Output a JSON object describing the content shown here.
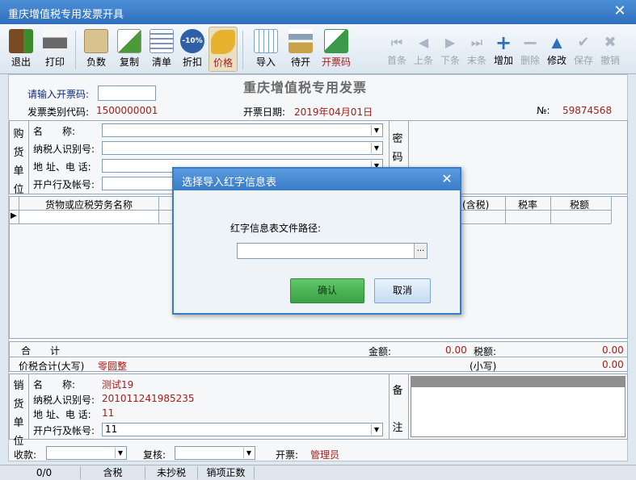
{
  "window": {
    "title": "重庆增值税专用发票开具"
  },
  "toolbar": {
    "left": [
      {
        "label": "退出",
        "icon": "exit-icon",
        "color": "#6b3e1e"
      },
      {
        "label": "打印",
        "icon": "printer-icon",
        "color": "#5a5a5a"
      },
      {
        "label": "负数",
        "icon": "folder-icon",
        "color": "#c9b07a"
      },
      {
        "label": "复制",
        "icon": "copy-icon",
        "color": "#4a9a3a"
      },
      {
        "label": "清单",
        "icon": "list-icon",
        "color": "#6a86b0"
      },
      {
        "label": "折扣",
        "icon": "discount-icon",
        "color": "#2f5fa8"
      },
      {
        "label": "价格",
        "icon": "price-tag-icon",
        "color": "#d9a41e"
      },
      {
        "label": "导入",
        "icon": "import-icon",
        "color": "#5a8fc8"
      },
      {
        "label": "待开",
        "icon": "hourglass-icon",
        "color": "#7a8fa8"
      },
      {
        "label": "开票码",
        "icon": "invoice-code-icon",
        "color": "#3a9a4a"
      }
    ],
    "right": [
      {
        "label": "首条",
        "icon": "first-record-icon"
      },
      {
        "label": "上条",
        "icon": "prev-record-icon"
      },
      {
        "label": "下条",
        "icon": "next-record-icon"
      },
      {
        "label": "末条",
        "icon": "last-record-icon"
      },
      {
        "label": "增加",
        "icon": "add-icon"
      },
      {
        "label": "删除",
        "icon": "delete-icon"
      },
      {
        "label": "修改",
        "icon": "modify-icon"
      },
      {
        "label": "保存",
        "icon": "save-icon"
      },
      {
        "label": "撤销",
        "icon": "undo-icon"
      }
    ],
    "discount_badge": "-10%"
  },
  "invoice": {
    "heading": "重庆增值税专用发票",
    "enter_code_label": "请输入开票码:",
    "type_code_label": "发票类别代码:",
    "type_code": "1500000001",
    "date_label": "开票日期:",
    "date": "2019年04月01日",
    "number_label": "№:",
    "number": "59874568"
  },
  "buyer": {
    "side_label": [
      "购",
      "货",
      "单",
      "位"
    ],
    "name_label": "名　　称:",
    "taxid_label": "纳税人识别号:",
    "address_label": "地 址、电 话:",
    "bank_label": "开户行及帐号:",
    "cipher_label": [
      "密",
      "码"
    ]
  },
  "goods": {
    "headers": [
      "货物或应税劳务名称",
      "(含税)",
      "税率",
      "税额"
    ],
    "row_marker": "▶"
  },
  "totals": {
    "sum_label": "合　　计",
    "amount_label": "金额:",
    "amount": "0.00",
    "tax_label": "税额:",
    "tax": "0.00",
    "total_upper_label": "价税合计(大写)",
    "total_upper": "零圆整",
    "small_label": "(小写)",
    "small": "0.00"
  },
  "seller": {
    "side_label": [
      "销",
      "货",
      "单",
      "位"
    ],
    "name_label": "名　　称:",
    "name": "测试19",
    "taxid_label": "纳税人识别号:",
    "taxid": "201011241985235",
    "address_label": "地 址、电 话:",
    "address": "11",
    "bank_label": "开户行及帐号:",
    "bank": "11",
    "remark_label": [
      "备",
      "注"
    ]
  },
  "footer": {
    "payee_label": "收款:",
    "review_label": "复核:",
    "issuer_label": "开票:",
    "issuer": "管理员"
  },
  "dialog": {
    "title": "选择导入红字信息表",
    "path_label": "红字信息表文件路径:",
    "browse": "...",
    "ok": "确认",
    "cancel": "取消"
  },
  "status": {
    "items": [
      "0/0",
      "含税",
      "未抄税",
      "销项正数"
    ]
  }
}
